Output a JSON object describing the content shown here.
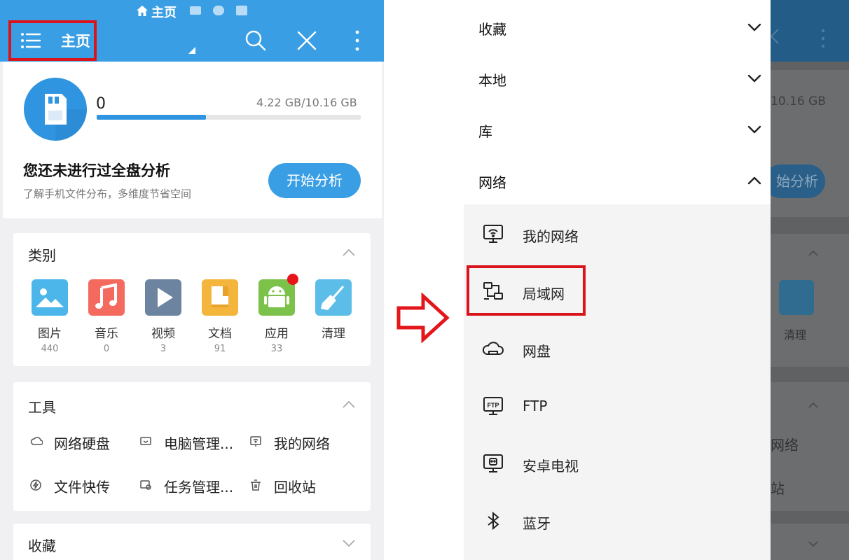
{
  "left_phone": {
    "status_bar": {
      "home_title": "主页"
    },
    "top_bar": {
      "title": "主页"
    },
    "storage": {
      "used_value": "0",
      "capacity": "4.22 GB/10.16 GB",
      "usage_fraction": 0.415,
      "analysis_title": "您还未进行过全盘分析",
      "analysis_subtitle": "了解手机文件分布，多维度节省空间",
      "analyze_button": "开始分析"
    },
    "categories": {
      "title": "类别",
      "items": [
        {
          "label": "图片",
          "count": "440",
          "icon": "image-icon",
          "color": "#4cb6ea"
        },
        {
          "label": "音乐",
          "count": "0",
          "icon": "music-icon",
          "color": "#f46a5e"
        },
        {
          "label": "视频",
          "count": "3",
          "icon": "video-icon",
          "color": "#6d84a0"
        },
        {
          "label": "文档",
          "count": "91",
          "icon": "document-icon",
          "color": "#f3b53c"
        },
        {
          "label": "应用",
          "count": "33",
          "icon": "android-icon",
          "color": "#7cc24a"
        },
        {
          "label": "清理",
          "count": "",
          "icon": "broom-icon",
          "color": "#5bbde8"
        }
      ]
    },
    "tools": {
      "title": "工具",
      "items": [
        {
          "label": "网络硬盘",
          "icon": "cloud-icon"
        },
        {
          "label": "电脑管理...",
          "icon": "pc-icon"
        },
        {
          "label": "我的网络",
          "icon": "wifi-monitor-icon"
        },
        {
          "label": "文件快传",
          "icon": "lightning-icon"
        },
        {
          "label": "任务管理...",
          "icon": "task-icon"
        },
        {
          "label": "回收站",
          "icon": "trash-icon"
        }
      ]
    },
    "favorites": {
      "title": "收藏"
    }
  },
  "right_phone": {
    "drawer_sections": [
      {
        "label": "收藏",
        "expanded": false
      },
      {
        "label": "本地",
        "expanded": false
      },
      {
        "label": "库",
        "expanded": false
      },
      {
        "label": "网络",
        "expanded": true
      }
    ],
    "network_items": [
      {
        "label": "我的网络",
        "icon": "wifi-monitor-icon"
      },
      {
        "label": "局域网",
        "icon": "lan-icon",
        "highlighted": true
      },
      {
        "label": "网盘",
        "icon": "cloud-drive-icon"
      },
      {
        "label": "FTP",
        "icon": "ftp-icon"
      },
      {
        "label": "安卓电视",
        "icon": "tv-icon"
      },
      {
        "label": "蓝牙",
        "icon": "bluetooth-icon"
      }
    ],
    "background_peek": {
      "capacity_fragment": "10.16 GB",
      "button_fragment": "始分析",
      "clean_label": "清理",
      "tool_fragment_1": "网络",
      "tool_fragment_2": "站"
    }
  },
  "colors": {
    "primary_blue": "#3a9ee4",
    "highlight_red": "#d9141b",
    "badge_red": "#e8141b"
  }
}
